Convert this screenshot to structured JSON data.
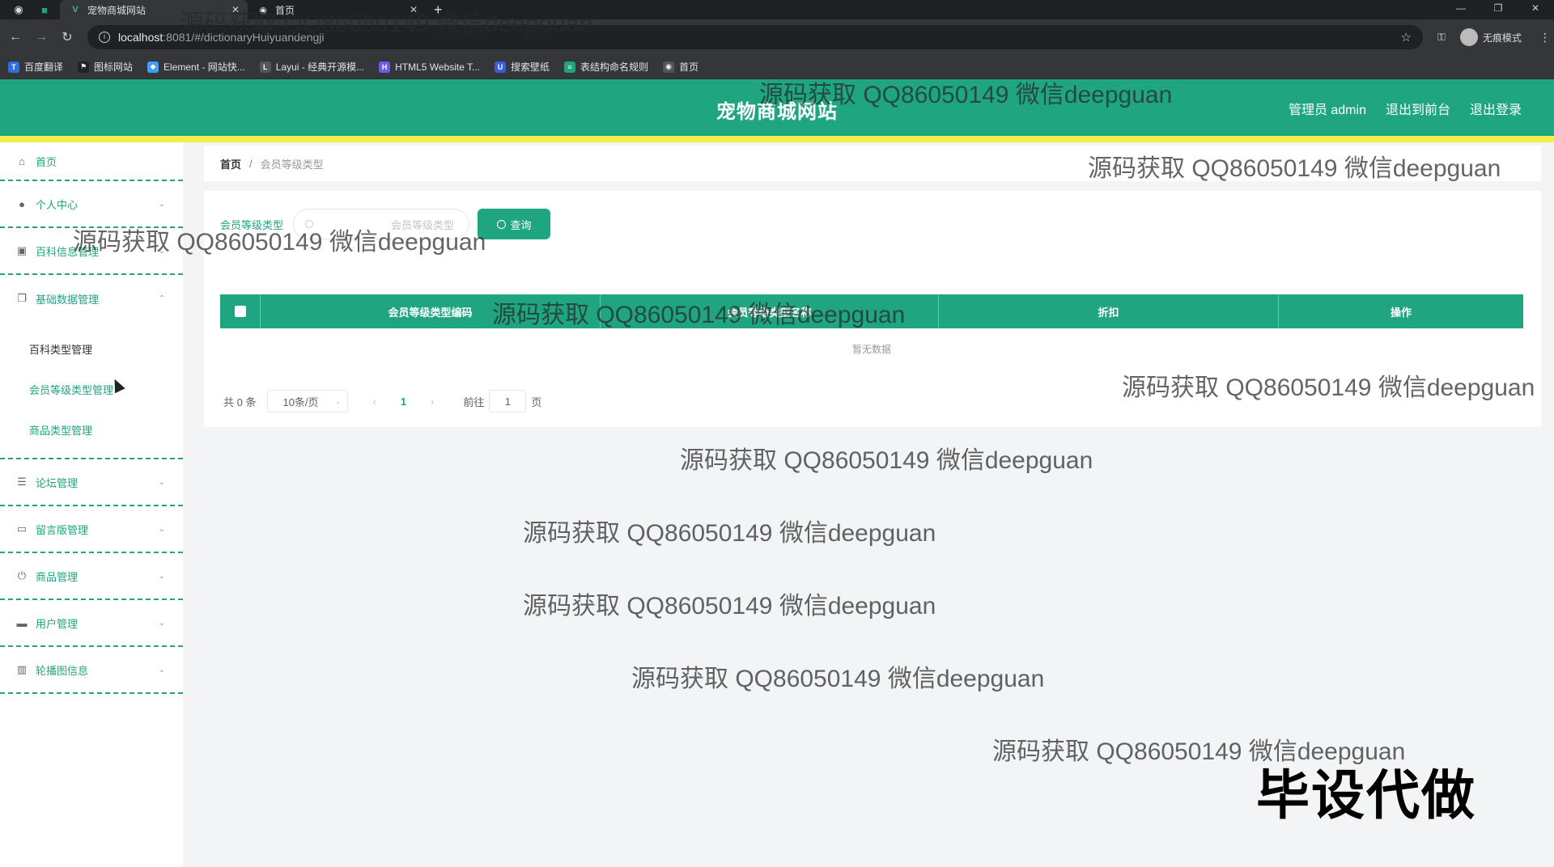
{
  "browser": {
    "tabs": [
      {
        "title": "宠物商城网站",
        "active": true
      },
      {
        "title": "首页",
        "active": false
      }
    ],
    "url_host": "localhost",
    "url_path": ":8081/#/dictionaryHuiyuandengji",
    "incognito_label": "无痕模式",
    "bookmarks": [
      "百度翻译",
      "图标网站",
      "Element - 网站快...",
      "Layui - 经典开源模...",
      "HTML5 Website T...",
      "搜索壁纸",
      "表结构命名规则",
      "首页"
    ]
  },
  "header": {
    "title": "宠物商城网站",
    "links": [
      "管理员 admin",
      "退出到前台",
      "退出登录"
    ]
  },
  "sidebar": {
    "items": [
      {
        "label": "首页",
        "icon": "home-icon"
      },
      {
        "label": "个人中心",
        "icon": "user-icon"
      },
      {
        "label": "百科信息管理",
        "icon": "clipboard-icon"
      },
      {
        "label": "基础数据管理",
        "icon": "copy-icon"
      },
      {
        "label": "论坛管理",
        "icon": "sliders-icon"
      },
      {
        "label": "留言版管理",
        "icon": "message-icon"
      },
      {
        "label": "商品管理",
        "icon": "power-icon"
      },
      {
        "label": "用户管理",
        "icon": "users-icon"
      },
      {
        "label": "轮播图信息",
        "icon": "bar-chart-icon"
      }
    ],
    "submenu": [
      "百科类型管理",
      "会员等级类型管理",
      "商品类型管理"
    ]
  },
  "breadcrumb": {
    "home": "首页",
    "separator": "/",
    "current": "会员等级类型"
  },
  "search": {
    "label": "会员等级类型",
    "placeholder": "会员等级类型",
    "button": "查询"
  },
  "table": {
    "columns": [
      "会员等级类型编码",
      "会员等级类型名称",
      "折扣",
      "操作"
    ],
    "empty_text": "暂无数据"
  },
  "pagination": {
    "total": "共 0 条",
    "page_size": "10条/页",
    "current_page": "1",
    "goto_label": "前往",
    "goto_value": "1",
    "page_suffix": "页"
  },
  "watermark": "源码获取 QQ86050149 微信deepguan",
  "stamp": "毕设代做",
  "colors": {
    "primary": "#1fa57f",
    "accent_bar": "#f1ef4a"
  }
}
